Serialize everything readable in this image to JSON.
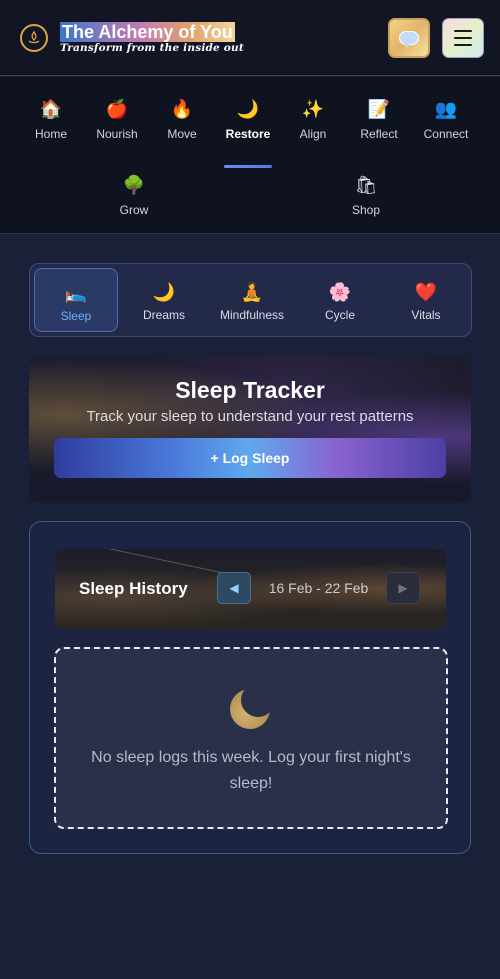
{
  "header": {
    "title": "The Alchemy of You",
    "subtitle": "Transform from the inside out",
    "logo_icon": "flame-lotus-icon",
    "chat_icon": "chat-bubble-icon",
    "menu_icon": "hamburger-menu-icon"
  },
  "main_nav": {
    "items": [
      {
        "label": "Home",
        "icon": "🏠"
      },
      {
        "label": "Nourish",
        "icon": "🍎"
      },
      {
        "label": "Move",
        "icon": "🔥"
      },
      {
        "label": "Restore",
        "icon": "🌙"
      },
      {
        "label": "Align",
        "icon": "✨"
      },
      {
        "label": "Reflect",
        "icon": "📝"
      },
      {
        "label": "Connect",
        "icon": "👥"
      },
      {
        "label": "Grow",
        "icon": "🌳"
      },
      {
        "label": "Shop",
        "icon": "🛍"
      }
    ],
    "active": "Restore"
  },
  "sub_tabs": {
    "items": [
      {
        "label": "Sleep",
        "icon": "🛌"
      },
      {
        "label": "Dreams",
        "icon": "🌙"
      },
      {
        "label": "Mindfulness",
        "icon": "🧘"
      },
      {
        "label": "Cycle",
        "icon": "🌸"
      },
      {
        "label": "Vitals",
        "icon": "❤️"
      }
    ],
    "active": "Sleep"
  },
  "tracker": {
    "title": "Sleep Tracker",
    "subtitle": "Track your sleep to understand your rest patterns",
    "log_button": "+ Log Sleep"
  },
  "history": {
    "title": "Sleep History",
    "prev_label": "◀",
    "next_label": "▶",
    "week_range": "16 Feb - 22 Feb",
    "empty_message": "No sleep logs this week. Log your first night's sleep!"
  },
  "colors": {
    "background": "#1b2039",
    "header_bg": "#121624",
    "active_accent": "#6fb0ff"
  }
}
